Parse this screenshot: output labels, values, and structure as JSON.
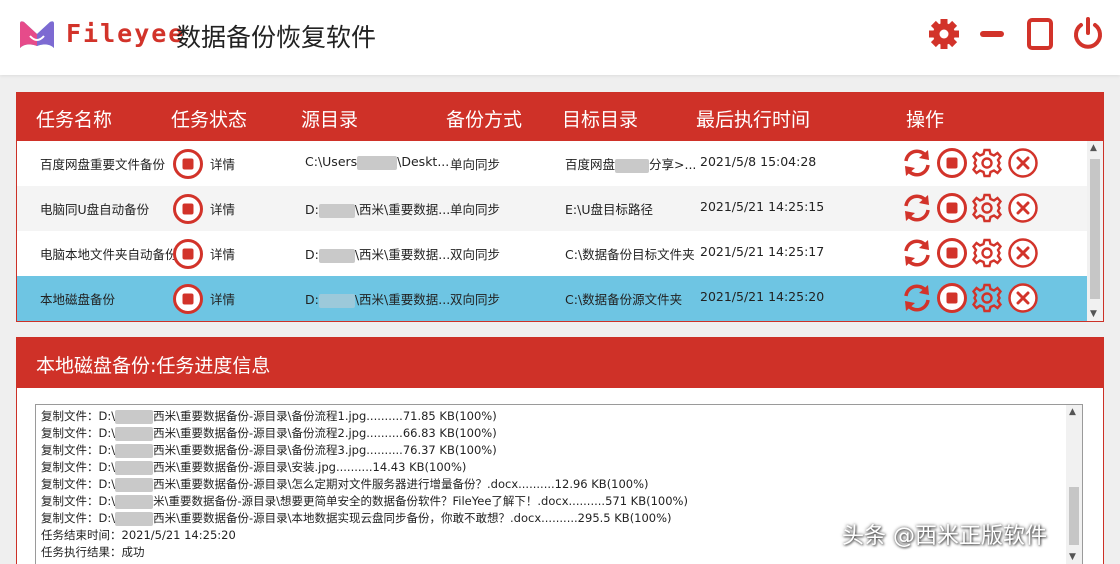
{
  "app": {
    "brand": "Fileyee",
    "title": "数据备份恢复软件",
    "accent": "#cf3128",
    "selected_row_color": "#6ec5e3"
  },
  "header_icons": [
    "gear-icon",
    "minimize-icon",
    "maximize-icon",
    "power-icon"
  ],
  "task_table": {
    "columns": [
      "任务名称",
      "任务状态",
      "源目录",
      "备份方式",
      "目标目录",
      "最后执行时间",
      "操作"
    ],
    "rows": [
      {
        "name": "百度网盘重要文件备份",
        "status": "详情",
        "src_a": "C:\\Users",
        "src_b": "\\Deskt...",
        "mode": "单向同步",
        "dst_a": "百度网盘",
        "dst_b": "分享>...",
        "time": "2021/5/8 15:04:28"
      },
      {
        "name": "电脑同U盘自动备份",
        "status": "详情",
        "src_a": "D:",
        "src_b": "\\西米\\重要数据...",
        "mode": "单向同步",
        "dst_a": "E:\\U盘目标路径",
        "dst_b": "",
        "time": "2021/5/21 14:25:15"
      },
      {
        "name": "电脑本地文件夹自动备份",
        "status": "详情",
        "src_a": "D:",
        "src_b": "\\西米\\重要数据...",
        "mode": "双向同步",
        "dst_a": "C:\\数据备份目标文件夹",
        "dst_b": "",
        "time": "2021/5/21 14:25:17"
      },
      {
        "name": "本地磁盘备份",
        "status": "详情",
        "src_a": "D:",
        "src_b": "\\西米\\重要数据...",
        "mode": "双向同步",
        "dst_a": "C:\\数据备份源文件夹",
        "dst_b": "",
        "time": "2021/5/21 14:25:20"
      }
    ],
    "row_actions": [
      "sync-icon",
      "stop-icon",
      "settings-icon",
      "delete-icon"
    ]
  },
  "progress": {
    "title": "本地磁盘备份:任务进度信息",
    "lines": [
      {
        "a": "复制文件：D:\\",
        "b": "西米\\重要数据备份-源目录\\备份流程1.jpg..........71.85 KB(100%)"
      },
      {
        "a": "复制文件：D:\\",
        "b": "西米\\重要数据备份-源目录\\备份流程2.jpg..........66.83 KB(100%)"
      },
      {
        "a": "复制文件：D:\\",
        "b": "西米\\重要数据备份-源目录\\备份流程3.jpg..........76.37 KB(100%)"
      },
      {
        "a": "复制文件：D:\\",
        "b": "西米\\重要数据备份-源目录\\安装.jpg..........14.43 KB(100%)"
      },
      {
        "a": "复制文件：D:\\",
        "b": "西米\\重要数据备份-源目录\\怎么定期对文件服务器进行增量备份？.docx..........12.96 KB(100%)"
      },
      {
        "a": "复制文件：D:\\",
        "b": "米\\重要数据备份-源目录\\想要更简单安全的数据备份软件？FileYee了解下！.docx..........571 KB(100%)"
      },
      {
        "a": "复制文件：D:\\",
        "b": "西米\\重要数据备份-源目录\\本地数据实现云盘同步备份，你敢不敢想？.docx..........295.5 KB(100%)"
      },
      {
        "a": "任务结束时间：2021/5/21 14:25:20",
        "b": ""
      },
      {
        "a": "任务执行结果：成功",
        "b": ""
      }
    ]
  },
  "watermark": "头条 @西米正版软件"
}
